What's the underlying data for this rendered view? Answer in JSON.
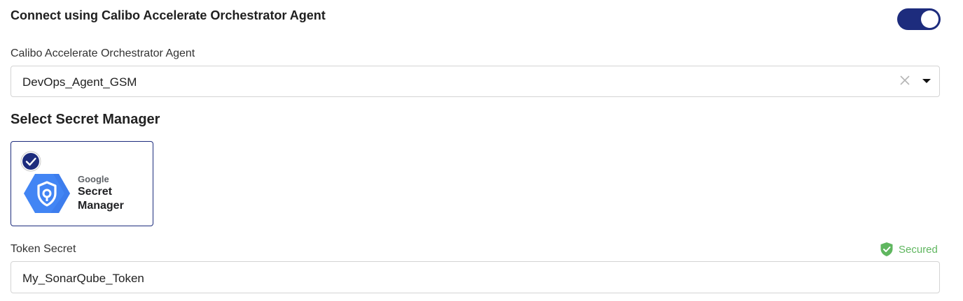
{
  "agent_section": {
    "title": "Connect using Calibo Accelerate Orchestrator Agent",
    "toggle_on": true,
    "accent_color": "#1d2c7d"
  },
  "agent_select": {
    "label": "Calibo Accelerate Orchestrator Agent",
    "value": "DevOps_Agent_GSM",
    "clear_icon": "close-icon",
    "dropdown_icon": "chevron-down-icon"
  },
  "secret_manager": {
    "title": "Select Secret Manager",
    "options": [
      {
        "brand": "Google",
        "name": "Secret Manager",
        "selected": true,
        "icon": "google-secret-manager-icon"
      }
    ]
  },
  "token_secret": {
    "label": "Token Secret",
    "status": "Secured",
    "status_color": "#5fb65f",
    "status_icon": "shield-check-icon",
    "value": "My_SonarQube_Token"
  }
}
